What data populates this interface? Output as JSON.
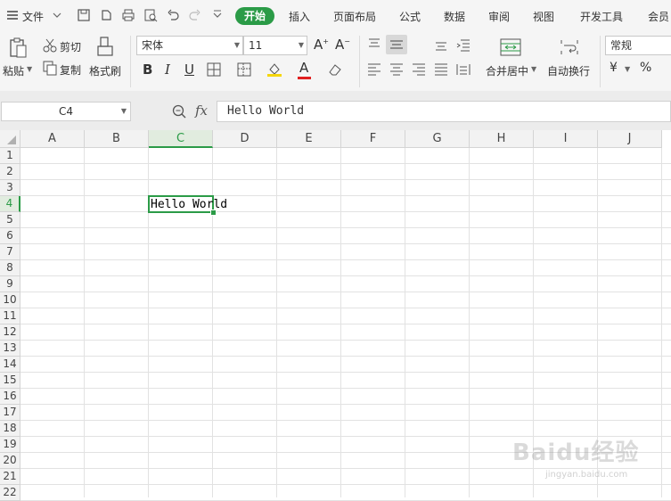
{
  "menubar": {
    "file_label": "文件",
    "tabs": [
      "开始",
      "插入",
      "页面布局",
      "公式",
      "数据",
      "审阅",
      "视图",
      "开发工具",
      "会员"
    ]
  },
  "ribbon": {
    "paste_label": "粘贴",
    "cut_label": "剪切",
    "copy_label": "复制",
    "format_painter_label": "格式刷",
    "font_name": "宋体",
    "font_size": "11",
    "merge_center_label": "合并居中",
    "wrap_text_label": "自动换行",
    "number_format": "常规",
    "currency_symbol": "¥",
    "percent_symbol": "%"
  },
  "formula_bar": {
    "name_box": "C4",
    "fx_label": "fx",
    "content": "Hello World"
  },
  "sheet": {
    "columns": [
      "A",
      "B",
      "C",
      "D",
      "E",
      "F",
      "G",
      "H",
      "I",
      "J"
    ],
    "rows": [
      "1",
      "2",
      "3",
      "4",
      "5",
      "6",
      "7",
      "8",
      "9",
      "10",
      "11",
      "12",
      "13",
      "14",
      "15",
      "16",
      "17",
      "18",
      "19",
      "20",
      "21",
      "22"
    ],
    "selected_column": "C",
    "selected_row": "4",
    "active_cell_value": "Hello World"
  },
  "watermark": {
    "brand": "Baidu经验",
    "url": "jingyan.baidu.com"
  },
  "colors": {
    "accent": "#2b9b47",
    "toolbar_bg": "#f5f5f5",
    "header_bg": "#f2f2f2"
  }
}
